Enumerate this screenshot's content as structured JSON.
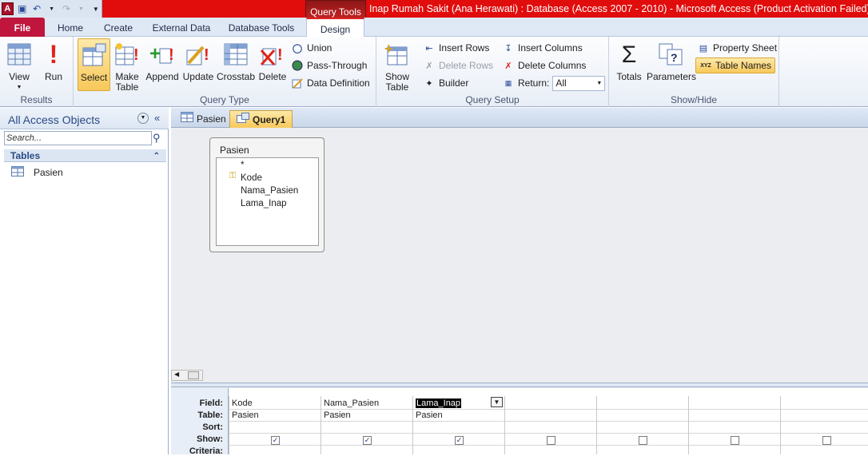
{
  "window": {
    "title": "Inap Rumah Sakit (Ana Herawati) : Database (Access 2007 - 2010)  -  Microsoft Access (Product Activation Failed)",
    "context_tab": "Query Tools"
  },
  "ribbon_tabs": [
    "File",
    "Home",
    "Create",
    "External Data",
    "Database Tools",
    "Design"
  ],
  "groups": {
    "results": {
      "label": "Results",
      "view": "View",
      "run": "Run"
    },
    "query_type": {
      "label": "Query Type",
      "select": "Select",
      "make_table_1": "Make",
      "make_table_2": "Table",
      "append": "Append",
      "update": "Update",
      "crosstab": "Crosstab",
      "delete": "Delete",
      "union": "Union",
      "pass_through": "Pass-Through",
      "data_definition": "Data Definition"
    },
    "query_setup": {
      "label": "Query Setup",
      "show_table_1": "Show",
      "show_table_2": "Table",
      "insert_rows": "Insert Rows",
      "delete_rows": "Delete Rows",
      "builder": "Builder",
      "insert_columns": "Insert Columns",
      "delete_columns": "Delete Columns",
      "return_label": "Return:",
      "return_value": "All"
    },
    "show_hide": {
      "label": "Show/Hide",
      "totals": "Totals",
      "parameters": "Parameters",
      "property_sheet": "Property Sheet",
      "table_names": "Table Names"
    }
  },
  "nav": {
    "title": "All Access Objects",
    "search_placeholder": "Search...",
    "section": "Tables",
    "items": [
      "Pasien"
    ]
  },
  "doc_tabs": [
    "Pasien",
    "Query1"
  ],
  "table_box": {
    "title": "Pasien",
    "fields": [
      "*",
      "Kode",
      "Nama_Pasien",
      "Lama_Inap"
    ]
  },
  "grid": {
    "row_labels": [
      "Field:",
      "Table:",
      "Sort:",
      "Show:",
      "Criteria:"
    ],
    "columns": [
      {
        "field": "Kode",
        "table": "Pasien",
        "show": true
      },
      {
        "field": "Nama_Pasien",
        "table": "Pasien",
        "show": true
      },
      {
        "field": "Lama_Inap",
        "table": "Pasien",
        "show": true
      },
      {
        "field": "",
        "table": "",
        "show": false
      },
      {
        "field": "",
        "table": "",
        "show": false
      },
      {
        "field": "",
        "table": "",
        "show": false
      },
      {
        "field": "",
        "table": "",
        "show": false
      }
    ]
  }
}
